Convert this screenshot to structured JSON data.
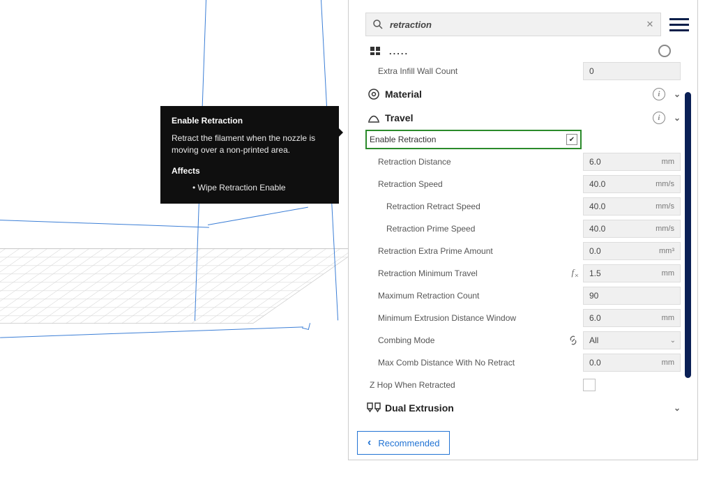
{
  "tooltip": {
    "title": "Enable Retraction",
    "desc": "Retract the filament when the nozzle is moving over a non-printed area.",
    "affects_label": "Affects",
    "affects_item": "• Wipe Retraction Enable"
  },
  "search": {
    "query": "retraction"
  },
  "truncated": {
    "dots": "....."
  },
  "infill": {
    "extra_wall_label": "Extra Infill Wall Count",
    "extra_wall_value": "0"
  },
  "sections": {
    "material": "Material",
    "travel": "Travel",
    "dual": "Dual Extrusion"
  },
  "enable_retraction": {
    "label": "Enable Retraction",
    "checked": "✔"
  },
  "settings": {
    "retraction_distance": {
      "label": "Retraction Distance",
      "value": "6.0",
      "unit": "mm"
    },
    "retraction_speed": {
      "label": "Retraction Speed",
      "value": "40.0",
      "unit": "mm/s"
    },
    "retraction_retract_speed": {
      "label": "Retraction Retract Speed",
      "value": "40.0",
      "unit": "mm/s"
    },
    "retraction_prime_speed": {
      "label": "Retraction Prime Speed",
      "value": "40.0",
      "unit": "mm/s"
    },
    "retraction_extra_prime": {
      "label": "Retraction Extra Prime Amount",
      "value": "0.0",
      "unit": "mm³"
    },
    "retraction_min_travel": {
      "label": "Retraction Minimum Travel",
      "value": "1.5",
      "unit": "mm"
    },
    "max_retraction_count": {
      "label": "Maximum Retraction Count",
      "value": "90",
      "unit": ""
    },
    "min_extrusion_window": {
      "label": "Minimum Extrusion Distance Window",
      "value": "6.0",
      "unit": "mm"
    },
    "combing_mode": {
      "label": "Combing Mode",
      "value": "All"
    },
    "max_comb_distance": {
      "label": "Max Comb Distance With No Retract",
      "value": "0.0",
      "unit": "mm"
    },
    "z_hop": {
      "label": "Z Hop When Retracted"
    }
  },
  "recommended_label": "Recommended"
}
